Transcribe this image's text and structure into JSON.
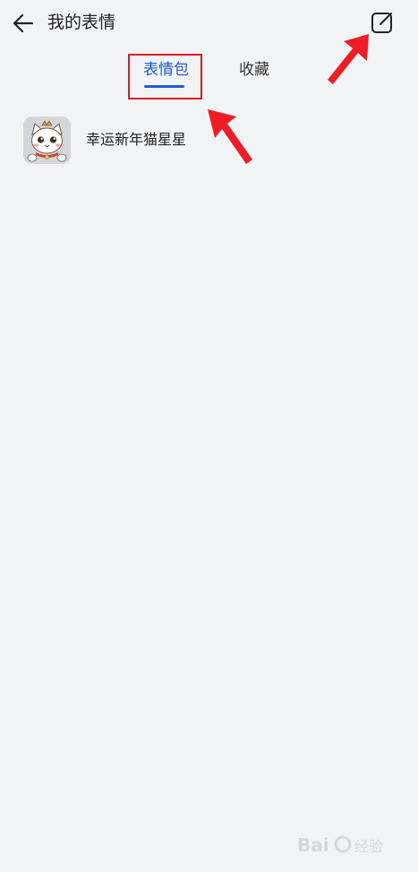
{
  "header": {
    "title": "我的表情"
  },
  "tabs": [
    {
      "label": "表情包",
      "active": true
    },
    {
      "label": "收藏",
      "active": false
    }
  ],
  "packs": [
    {
      "name": "幸运新年猫星星",
      "icon": "cat-sticker-thumbnail"
    }
  ],
  "icons": {
    "back": "arrow-left-icon",
    "edit": "edit-square-icon"
  },
  "colors": {
    "accent": "#1f5bd8",
    "annotation": "#e01b24",
    "background": "#f2f3f5"
  },
  "watermark": "Bai 经验"
}
